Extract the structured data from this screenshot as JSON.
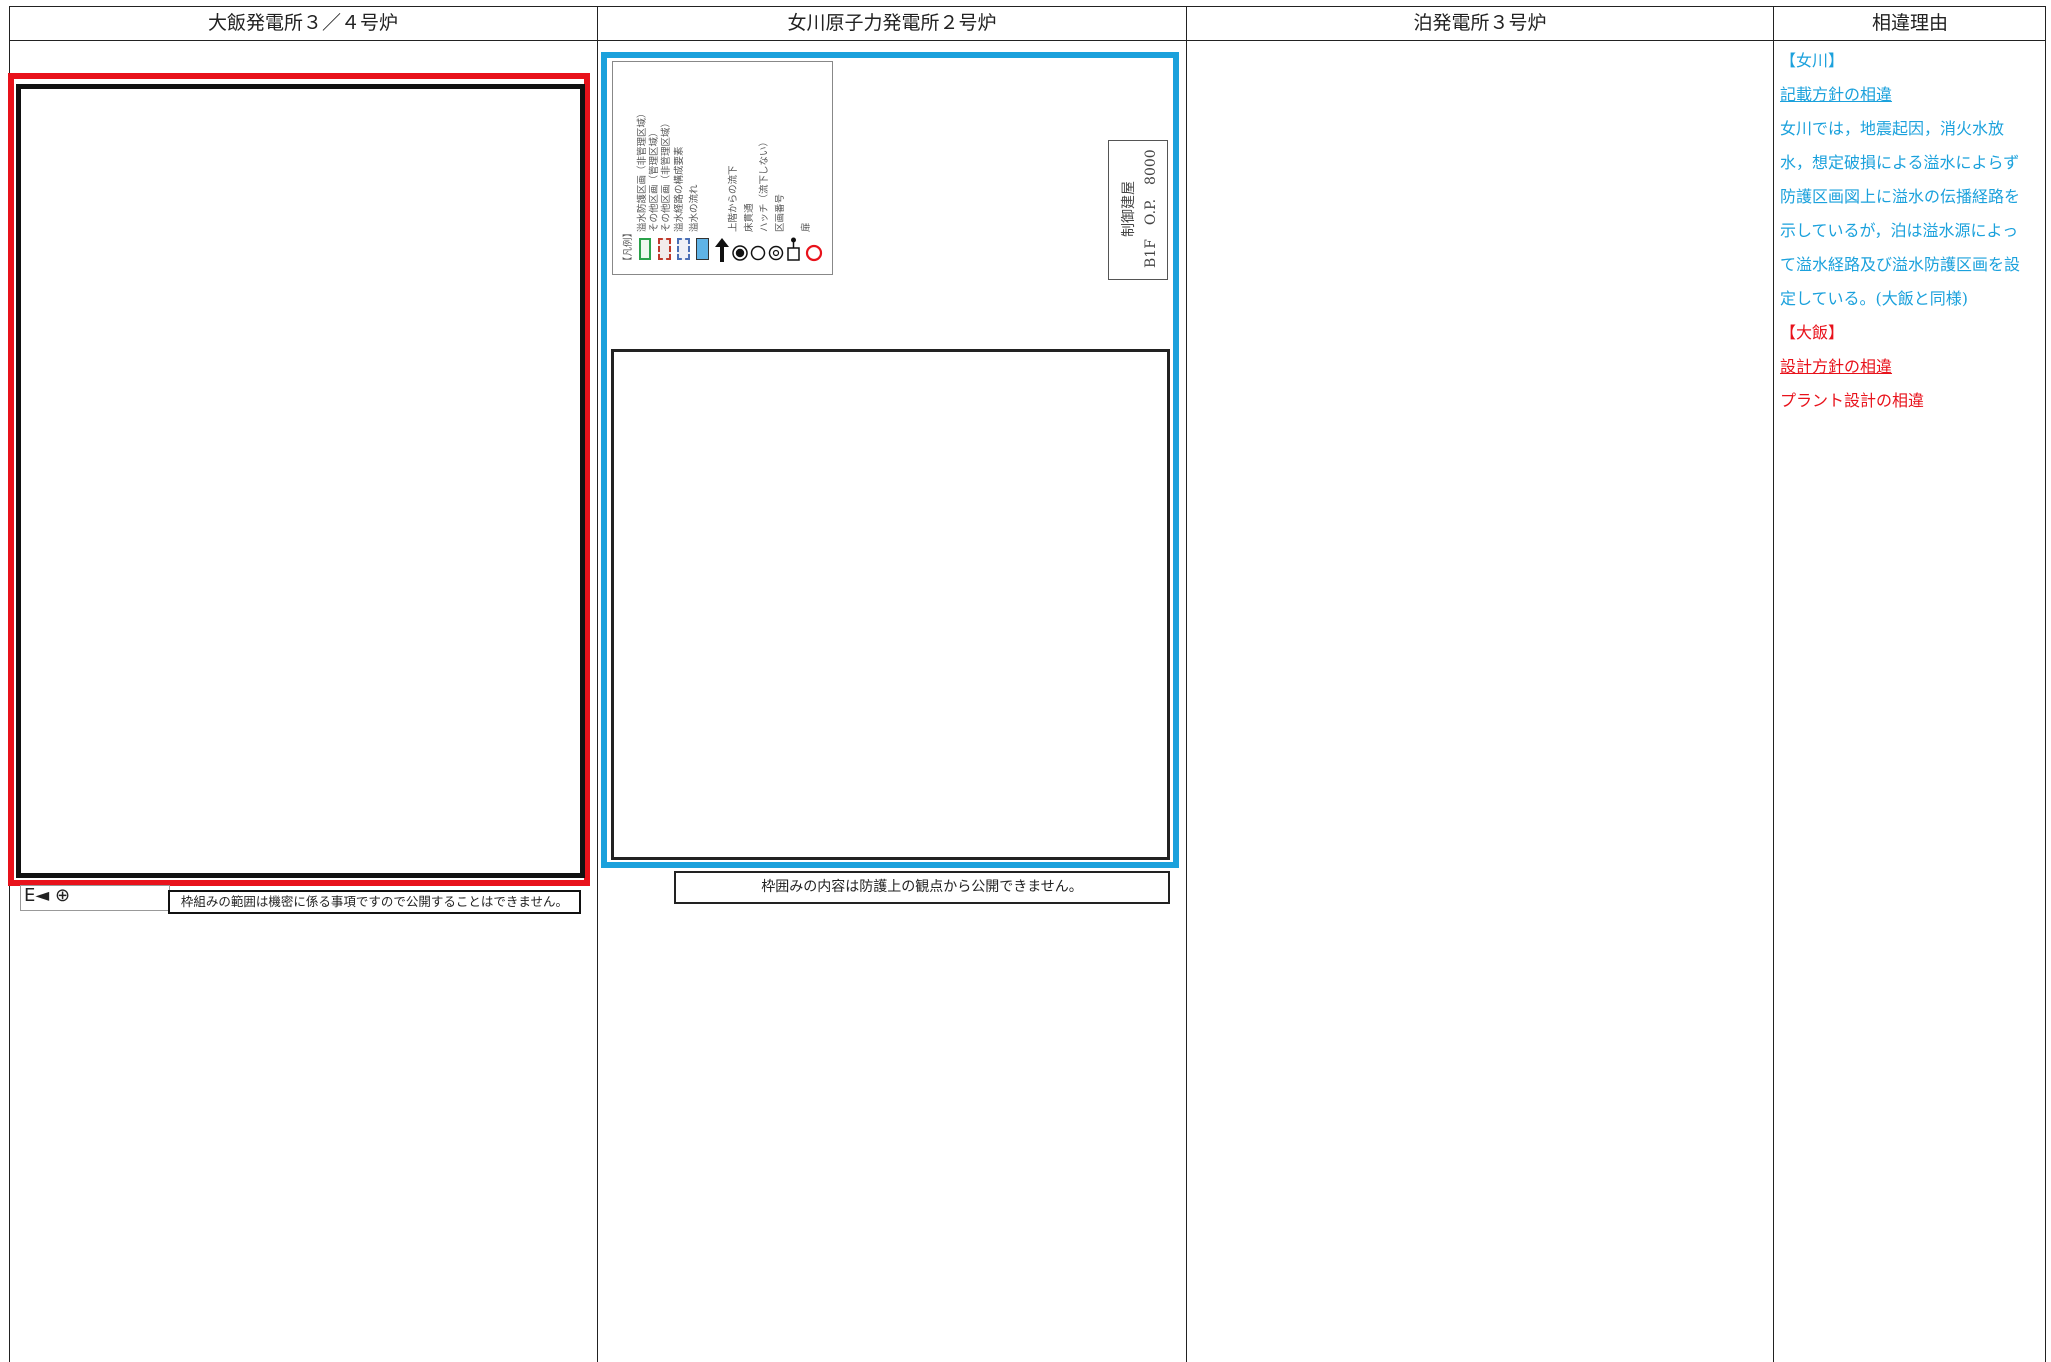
{
  "headers": {
    "ohi": "大飯発電所３／４号炉",
    "onagawa": "女川原子力発電所２号炉",
    "tomari": "泊発電所３号炉",
    "reason": "相違理由"
  },
  "ohi": {
    "legend_symbols": "E◄ ⊕",
    "note": "枠組みの範囲は機密に係る事項ですので公開することはできません。"
  },
  "onagawa": {
    "legend_title": "【凡例】",
    "legend_items": [
      "溢水防護区画（非管理区域）",
      "その他区画（管理区域）",
      "その他区画（非管理区域）",
      "溢水経路の構成要素",
      "溢水の流れ",
      "上階からの流下",
      "床貫通",
      "ハッチ（流下しない）",
      "区画番号",
      "扉"
    ],
    "control_room_label": "制御建屋",
    "floor_label": "B1F　O.P.　8000",
    "note": "枠囲みの内容は防護上の観点から公開できません。"
  },
  "reason": {
    "onagawa_tag": "【女川】",
    "onagawa_heading": "記載方針の相違",
    "onagawa_lines": [
      "女川では，地震起因，消火水放",
      "水，想定破損による溢水によらず",
      "防護区画図上に溢水の伝播経路を",
      "示しているが，泊は溢水源によっ",
      "て溢水経路及び溢水防護区画を設",
      "定している。(大飯と同様)"
    ],
    "ohi_tag": "【大飯】",
    "ohi_heading": "設計方針の相違",
    "ohi_line": "プラント設計の相違"
  },
  "colors": {
    "ohi_accent": "#e8121b",
    "onagawa_accent": "#1ba1dc"
  }
}
